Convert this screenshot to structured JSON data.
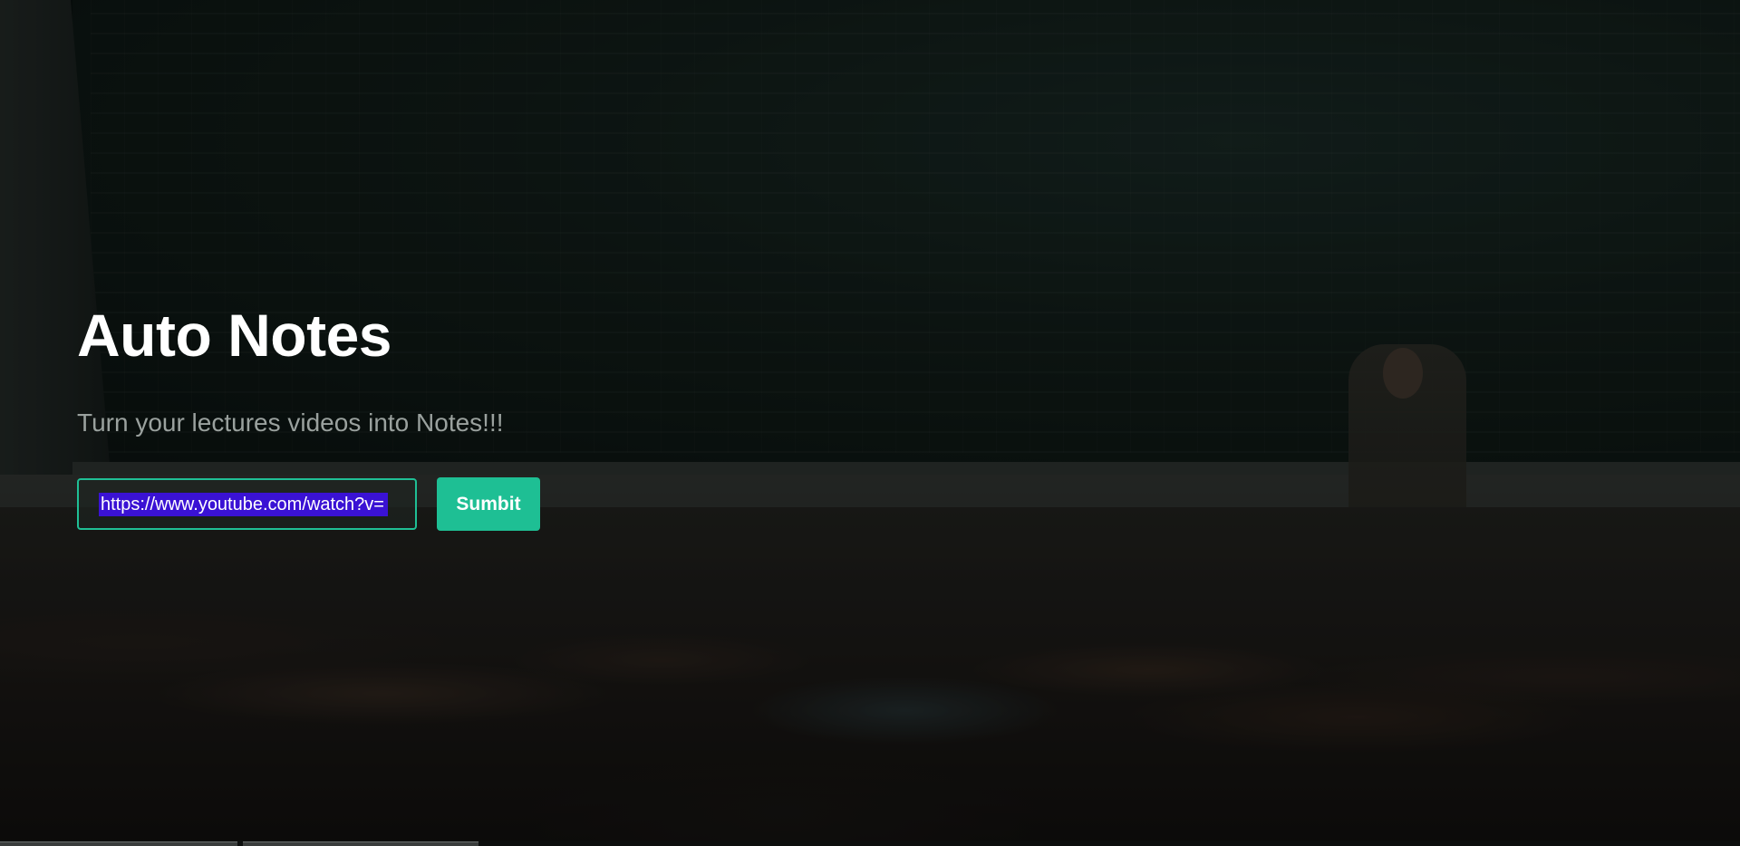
{
  "hero": {
    "title": "Auto Notes",
    "subtitle": "Turn your lectures videos into Notes!!!"
  },
  "form": {
    "url_value": "https://www.youtube.com/watch?v=",
    "submit_label": "Sumbit"
  },
  "colors": {
    "accent": "#1ebf94",
    "selection": "#3a12d4",
    "title": "#ffffff",
    "subtitle": "#9aa19e"
  },
  "background": {
    "icon": "lecture-hall-photo"
  }
}
